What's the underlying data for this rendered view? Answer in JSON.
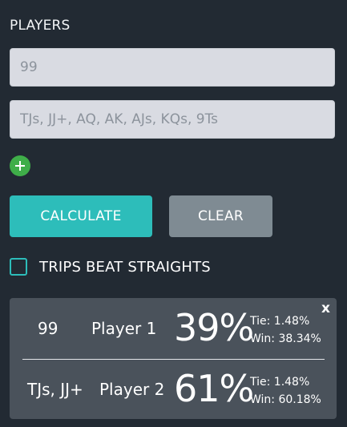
{
  "section_title": "PLAYERS",
  "players": [
    {
      "value": "",
      "placeholder": "99"
    },
    {
      "value": "",
      "placeholder": "TJs, JJ+, AQ, AK, AJs, KQs, 9Ts"
    }
  ],
  "add_player_icon": "plus-icon",
  "buttons": {
    "calculate": "CALCULATE",
    "clear": "CLEAR"
  },
  "options": {
    "trips_label": "TRIPS BEAT STRAIGHTS",
    "trips_checked": false
  },
  "results": {
    "close_label": "x",
    "rows": [
      {
        "hand": "99",
        "player": "Player 1",
        "equity": "39%",
        "tie": "Tie: 1.48%",
        "win": "Win: 38.34%"
      },
      {
        "hand": "TJs, JJ+",
        "player": "Player 2",
        "equity": "61%",
        "tie": "Tie: 1.48%",
        "win": "Win: 60.18%"
      }
    ]
  },
  "colors": {
    "background": "#222a33",
    "accent": "#2dbdba",
    "clear_button": "#7f8b93",
    "add_button": "#3fae49",
    "panel": "#4a525b"
  }
}
